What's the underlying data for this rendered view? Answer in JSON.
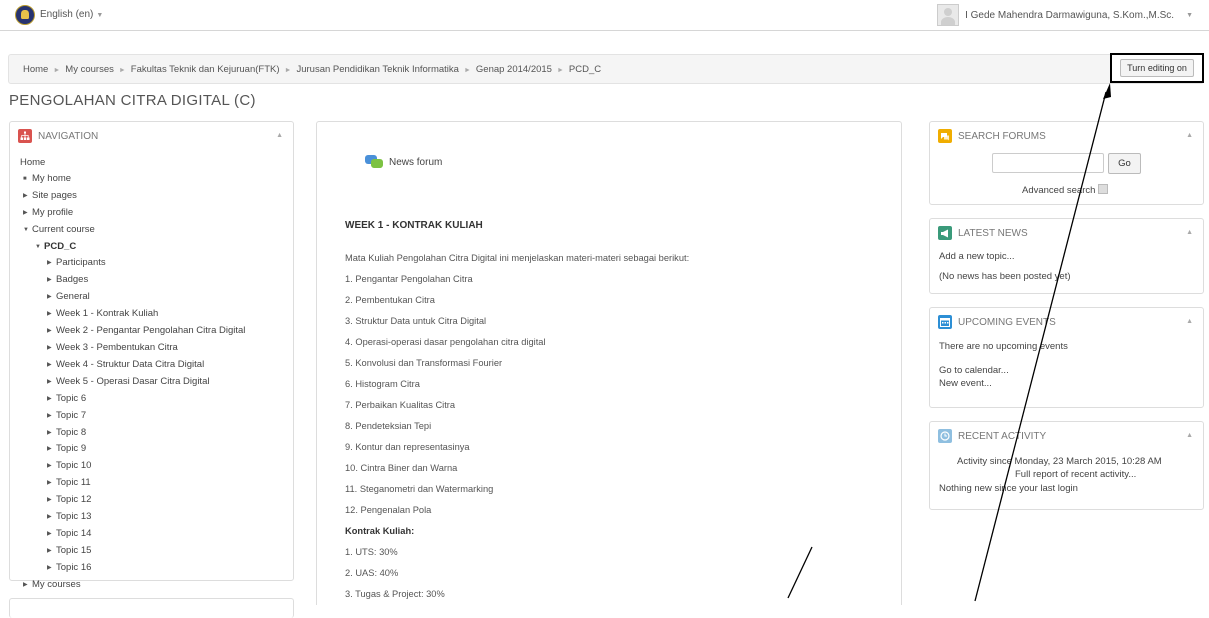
{
  "header": {
    "language": "English (en)",
    "user_name": "I Gede Mahendra Darmawiguna, S.Kom.,M.Sc."
  },
  "breadcrumb": [
    "Home",
    "My courses",
    "Fakultas Teknik dan Kejuruan(FTK)",
    "Jurusan Pendidikan Teknik Informatika",
    "Genap 2014/2015",
    "PCD_C"
  ],
  "edit_button": "Turn editing on",
  "page_title": "PENGOLAHAN CITRA DIGITAL (C)",
  "navigation": {
    "title": "NAVIGATION",
    "items": [
      {
        "label": "Home"
      },
      {
        "label": "My home"
      },
      {
        "label": "Site pages"
      },
      {
        "label": "My profile"
      },
      {
        "label": "Current course"
      },
      {
        "label": "PCD_C"
      },
      {
        "label": "Participants"
      },
      {
        "label": "Badges"
      },
      {
        "label": "General"
      },
      {
        "label": "Week 1 - Kontrak Kuliah"
      },
      {
        "label": "Week 2 - Pengantar Pengolahan Citra Digital"
      },
      {
        "label": "Week 3 - Pembentukan Citra"
      },
      {
        "label": "Week 4 - Struktur Data Citra Digital"
      },
      {
        "label": "Week 5 - Operasi Dasar Citra Digital"
      },
      {
        "label": "Topic 6"
      },
      {
        "label": "Topic 7"
      },
      {
        "label": "Topic 8"
      },
      {
        "label": "Topic 9"
      },
      {
        "label": "Topic 10"
      },
      {
        "label": "Topic 11"
      },
      {
        "label": "Topic 12"
      },
      {
        "label": "Topic 13"
      },
      {
        "label": "Topic 14"
      },
      {
        "label": "Topic 15"
      },
      {
        "label": "Topic 16"
      },
      {
        "label": "My courses"
      }
    ]
  },
  "main": {
    "news_forum": "News forum",
    "week_title": "WEEK 1 - KONTRAK KULIAH",
    "intro": "Mata Kuliah Pengolahan Citra Digital ini menjelaskan materi-materi sebagai berikut:",
    "topics": [
      "1. Pengantar Pengolahan Citra",
      "2. Pembentukan Citra",
      "3. Struktur Data untuk Citra Digital",
      "4. Operasi-operasi dasar pengolahan citra digital",
      "5. Konvolusi dan Transformasi Fourier",
      "6. Histogram Citra",
      "7. Perbaikan Kualitas Citra",
      "8. Pendeteksian Tepi",
      "9. Kontur dan representasinya",
      "10. Cintra Biner dan Warna",
      "11. Steganometri dan Watermarking",
      "12. Pengenalan Pola"
    ],
    "contract_title": "Kontrak Kuliah:",
    "contract": [
      "1. UTS: 30%",
      "2. UAS: 40%",
      "3. Tugas & Project: 30%"
    ]
  },
  "search_forums": {
    "title": "SEARCH FORUMS",
    "go": "Go",
    "advanced": "Advanced search"
  },
  "latest_news": {
    "title": "LATEST NEWS",
    "add": "Add a new topic...",
    "none": "(No news has been posted yet)"
  },
  "upcoming_events": {
    "title": "UPCOMING EVENTS",
    "none": "There are no upcoming events",
    "calendar": "Go to calendar...",
    "new_event": "New event..."
  },
  "recent_activity": {
    "title": "RECENT ACTIVITY",
    "since": "Activity since Monday, 23 March 2015, 10:28 AM",
    "full_report": "Full report of recent activity...",
    "nothing": "Nothing new since your last login"
  },
  "colors": {
    "nav_icon": "#d9534f",
    "search_icon": "#f0ad00",
    "news_icon": "#3a9a7a",
    "events_icon": "#2d8fd5",
    "activity_icon": "#8fbfe0"
  }
}
